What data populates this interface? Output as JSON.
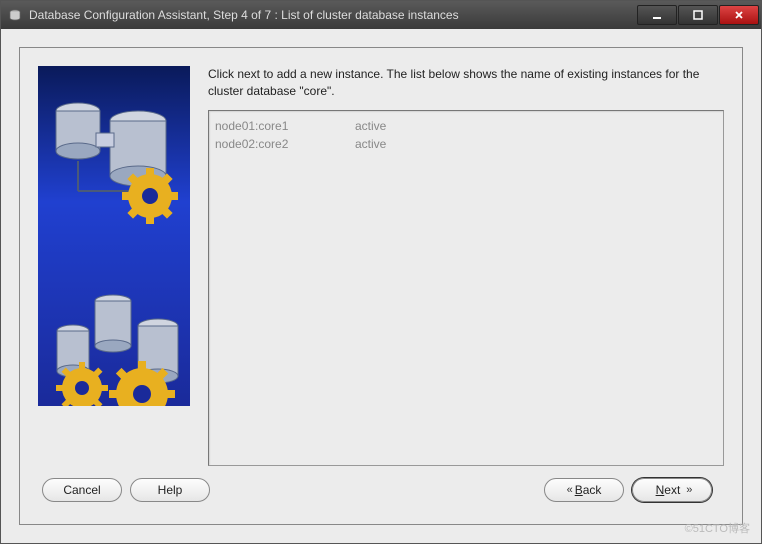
{
  "window": {
    "title": "Database Configuration Assistant, Step 4 of 7 : List of cluster database instances"
  },
  "instruction": "Click next to add a new instance. The list below shows the name of existing instances for the cluster database \"core\".",
  "instances": [
    {
      "name": "node01:core1",
      "status": "active"
    },
    {
      "name": "node02:core2",
      "status": "active"
    }
  ],
  "buttons": {
    "cancel": "Cancel",
    "help": "Help",
    "back_prefix": "B",
    "back_rest": "ack",
    "next_prefix": "N",
    "next_rest": "ext"
  },
  "watermark": "©51CTO博客"
}
